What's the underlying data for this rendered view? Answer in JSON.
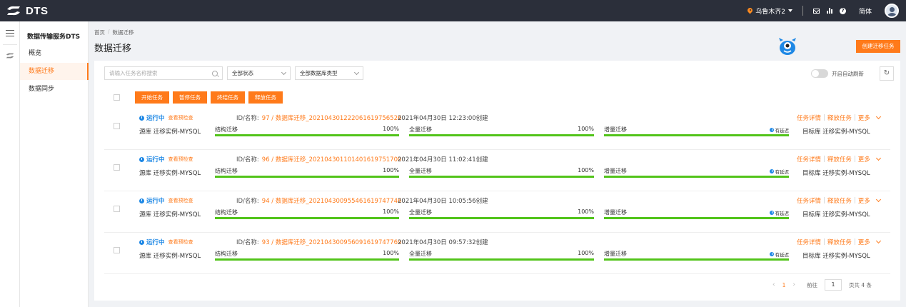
{
  "header": {
    "brand": "DTS",
    "region": "乌鲁木齐2",
    "language": "简体",
    "icons": [
      "location-pin-icon",
      "mail-icon",
      "chart-icon",
      "help-icon",
      "user-avatar-icon"
    ]
  },
  "menu": {
    "title": "数据传输服务DTS",
    "items": [
      {
        "label": "概览",
        "active": false
      },
      {
        "label": "数据迁移",
        "active": true
      },
      {
        "label": "数据同步",
        "active": false
      }
    ]
  },
  "breadcrumb": {
    "home": "首页",
    "current": "数据迁移"
  },
  "page_title": "数据迁移",
  "create_button": "创建迁移任务",
  "filters": {
    "search_placeholder": "请输入任务名称搜索",
    "status_select": "全部状态",
    "dbtype_select": "全部数据库类型",
    "auto_refresh_label": "开启自动刷新",
    "refresh_icon": "↻"
  },
  "batch_actions": [
    "开始任务",
    "暂停任务",
    "终结任务",
    "释放任务"
  ],
  "colors": {
    "accent": "#ff7a1a",
    "running": "#1e88e5",
    "progress": "#52c41a"
  },
  "task_labels": {
    "id_name": "ID/名称:",
    "precheck": "查看预检查",
    "source_prefix": "源库",
    "target_prefix": "目标库",
    "phase_structure": "结构迁移",
    "phase_full": "全量迁移",
    "phase_incremental": "增量迁移",
    "delay_text": "有延迟",
    "action_detail": "任务详情",
    "action_release": "释放任务",
    "action_more": "更多"
  },
  "tasks": [
    {
      "status": "运行中",
      "id_name": "97 / 数据库迁移_20210430122206161975652​6",
      "created": "2021年04月30日 12:23:00创建",
      "source": "迁移实例-MYSQL",
      "target": "迁移实例-MYSQL",
      "structure_pct": "100%",
      "full_pct": "100%",
      "structure_progress": 1.0,
      "full_progress": 1.0,
      "incremental_progress": 1.0
    },
    {
      "status": "运行中",
      "id_name": "96 / 数据库迁移_20210430110140161975170​0",
      "created": "2021年04月30日 11:02:41创建",
      "source": "迁移实例-MYSQL",
      "target": "迁移实例-MYSQL",
      "structure_pct": "100%",
      "full_pct": "100%",
      "structure_progress": 1.0,
      "full_progress": 1.0,
      "incremental_progress": 1.0
    },
    {
      "status": "运行中",
      "id_name": "94 / 数据库迁移_20210430095546161974774​6",
      "created": "2021年04月30日 10:05:56创建",
      "source": "迁移实例-MYSQL",
      "target": "迁移实例-MYSQL",
      "structure_pct": "100%",
      "full_pct": "100%",
      "structure_progress": 1.0,
      "full_progress": 1.0,
      "incremental_progress": 1.0
    },
    {
      "status": "运行中",
      "id_name": "93 / 数据库迁移_20210430095609161974776​9",
      "created": "2021年04月30日 09:57:32创建",
      "source": "迁移实例-MYSQL",
      "target": "迁移实例-MYSQL",
      "structure_pct": "100%",
      "full_pct": "100%",
      "structure_progress": 1.0,
      "full_progress": 1.0,
      "incremental_progress": 1.0
    }
  ],
  "pagination": {
    "prev": "‹",
    "current_page": "1",
    "next": "›",
    "goto_label": "前往",
    "goto_value": "1",
    "total": "页共 4 条"
  }
}
